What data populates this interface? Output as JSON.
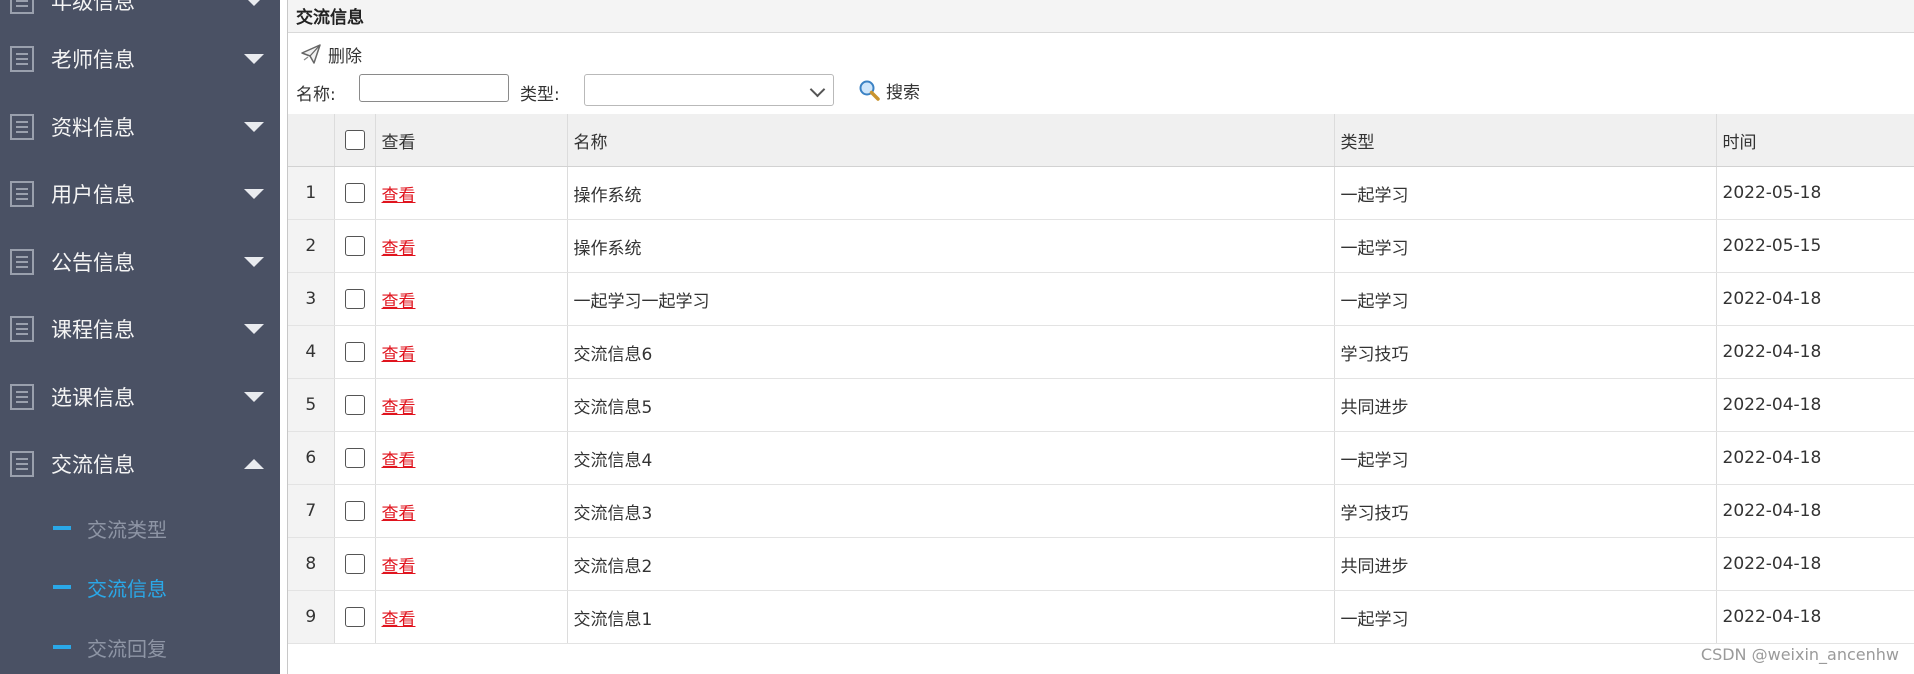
{
  "sidebar": {
    "items": [
      {
        "label": "年级信息",
        "expanded": false
      },
      {
        "label": "老师信息",
        "expanded": false
      },
      {
        "label": "资料信息",
        "expanded": false
      },
      {
        "label": "用户信息",
        "expanded": false
      },
      {
        "label": "公告信息",
        "expanded": false
      },
      {
        "label": "课程信息",
        "expanded": false
      },
      {
        "label": "选课信息",
        "expanded": false
      },
      {
        "label": "交流信息",
        "expanded": true
      }
    ],
    "subitems": [
      {
        "label": "交流类型",
        "active": false
      },
      {
        "label": "交流信息",
        "active": true
      },
      {
        "label": "交流回复",
        "active": false
      }
    ]
  },
  "panel": {
    "title": "交流信息"
  },
  "toolbar": {
    "delete_label": "删除"
  },
  "search": {
    "name_label": "名称:",
    "name_value": "",
    "type_label": "类型:",
    "type_value": "",
    "button_label": "搜索"
  },
  "table": {
    "columns": [
      "查看",
      "名称",
      "类型",
      "时间"
    ],
    "view_link_text": "查看",
    "rows": [
      {
        "num": "1",
        "name": "操作系统",
        "type": "一起学习",
        "time": "2022-05-18"
      },
      {
        "num": "2",
        "name": "操作系统",
        "type": "一起学习",
        "time": "2022-05-15"
      },
      {
        "num": "3",
        "name": "一起学习一起学习",
        "type": "一起学习",
        "time": "2022-04-18"
      },
      {
        "num": "4",
        "name": "交流信息6",
        "type": "学习技巧",
        "time": "2022-04-18"
      },
      {
        "num": "5",
        "name": "交流信息5",
        "type": "共同进步",
        "time": "2022-04-18"
      },
      {
        "num": "6",
        "name": "交流信息4",
        "type": "一起学习",
        "time": "2022-04-18"
      },
      {
        "num": "7",
        "name": "交流信息3",
        "type": "学习技巧",
        "time": "2022-04-18"
      },
      {
        "num": "8",
        "name": "交流信息2",
        "type": "共同进步",
        "time": "2022-04-18"
      },
      {
        "num": "9",
        "name": "交流信息1",
        "type": "一起学习",
        "time": "2022-04-18"
      }
    ]
  },
  "watermark": "CSDN @weixin_ancenhw",
  "colors": {
    "sidebar_bg": "#4a5164",
    "accent": "#2aa8e8",
    "link": "#e0141e"
  },
  "icons": {
    "nav": "list-icon",
    "delete": "paper-plane-icon",
    "search": "magnifier-icon"
  }
}
